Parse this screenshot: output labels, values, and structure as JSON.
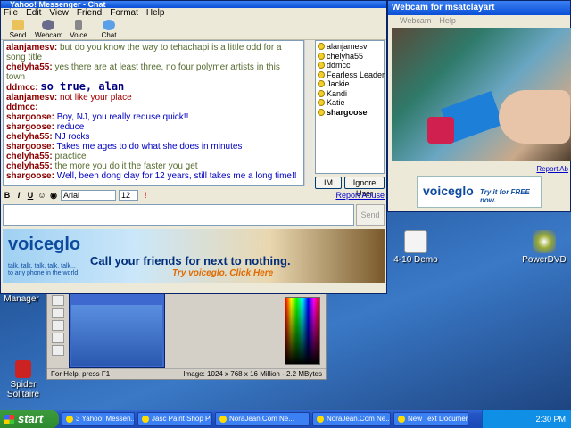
{
  "chat": {
    "title": "Yahoo! Messenger - Chat",
    "menu": [
      "File",
      "Edit",
      "View",
      "Friend",
      "Format",
      "Help"
    ],
    "toolbar": [
      "Send File",
      "Webcam",
      "Voice",
      "Chat"
    ],
    "messages": [
      {
        "sn": "alanjamesv:",
        "text": "but do you know the way to tehachapi is a little odd for a song title",
        "color": "c-olive"
      },
      {
        "sn": "chelyha55:",
        "text": "yes there are at least three, no four polymer artists in this town",
        "color": "c-olive"
      },
      {
        "sn": "ddmcc:",
        "text": "so true, alan",
        "color": "big"
      },
      {
        "sn": "alanjamesv:",
        "text": "not like your place",
        "color": "c-red"
      },
      {
        "sn": "ddmcc:",
        "text": "",
        "color": "c-red"
      },
      {
        "sn": "shargoose:",
        "text": "Boy, NJ, you really reduse quick!!",
        "color": "c-blue"
      },
      {
        "sn": "shargoose:",
        "text": "reduce",
        "color": "c-blue"
      },
      {
        "sn": "chelyha55:",
        "text": "NJ rocks",
        "color": "c-blue"
      },
      {
        "sn": "shargoose:",
        "text": "Takes me ages to do what she does in minutes",
        "color": "c-blue"
      },
      {
        "sn": "chelyha55:",
        "text": "practice",
        "color": "c-olive"
      },
      {
        "sn": "chelyha55:",
        "text": "the more you do it the faster you get",
        "color": "c-olive"
      },
      {
        "sn": "shargoose:",
        "text": "Well, been dong clay for 12 years, still takes me a long time!!",
        "color": "c-blue"
      }
    ],
    "buddies": [
      "alanjamesv",
      "chelyha55",
      "ddmcc",
      "Fearless Leader",
      "Jackie",
      "Kandi",
      "Katie",
      "shargoose"
    ],
    "im_label": "IM",
    "ignore_label": "Ignore User",
    "font_name": "Arial",
    "font_size": "12",
    "report_abuse": "Report Abuse",
    "send_label": "Send",
    "ad": {
      "logo": "voiceglo",
      "tagline": "talk. talk. talk. talk. talk... to any phone in the world",
      "headline": "Call your friends for next to nothing.",
      "cta": "Try voiceglo. Click Here"
    }
  },
  "webcam": {
    "title": "Webcam for msatclayart",
    "menu": [
      "Webcam",
      "Help"
    ],
    "report": "Report Ab",
    "banner_logo": "voiceglo",
    "banner_cta": "Try it for FREE now."
  },
  "psp": {
    "status_left": "For Help, press F1",
    "status_right": "Image:  1024 x 768 x 16 Million - 2.2 MBytes"
  },
  "desktop": {
    "icon_demo": "4-10 Demo",
    "icon_powerdvd": "PowerDVD",
    "icon_spider": "Spider Solitaire",
    "icon_manager": "Manager"
  },
  "taskbar": {
    "start": "start",
    "tasks": [
      "3 Yahoo! Messen...",
      "Jasc Paint Shop Pr...",
      "NoraJean.Com Ne...",
      "NoraJean.Com Ne...",
      "New Text Documen..."
    ],
    "clock": "2:30 PM"
  }
}
